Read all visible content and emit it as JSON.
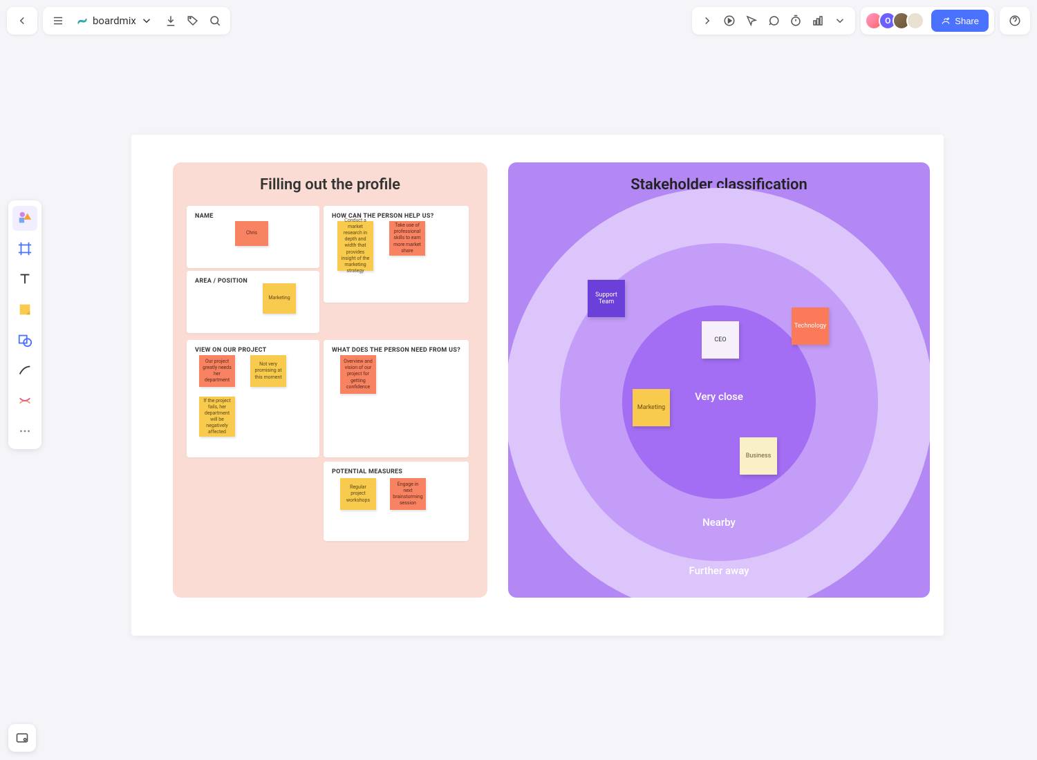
{
  "app": {
    "name": "boardmix",
    "avatar_letter": "O"
  },
  "share": {
    "label": "Share"
  },
  "profile": {
    "title": "Filling out the profile",
    "sections": {
      "name": {
        "label": "NAME",
        "notes": [
          "Chris"
        ]
      },
      "area": {
        "label": "AREA / POSITION",
        "notes": [
          "Marketing"
        ]
      },
      "help": {
        "label": "HOW CAN THE PERSON HELP US?",
        "notes": [
          "Conduct a market research in depth and width that provides insight of the marketing strategy",
          "Take use of professional skills to earn more market share"
        ]
      },
      "view": {
        "label": "VIEW ON OUR PROJECT",
        "notes": [
          "Our project greatly needs her department",
          "Not very promising at this moment",
          "If the project fails, her department will be negatively affected"
        ]
      },
      "need": {
        "label": "WHAT DOES THE PERSON NEED FROM US?",
        "notes": [
          "Overview and vision of our project for getting confidence"
        ]
      },
      "measures": {
        "label": "POTENTIAL MEASURES",
        "notes": [
          "Regular project workshops",
          "Engage in next brainstorming session"
        ]
      }
    }
  },
  "stakeholder": {
    "title": "Stakeholder classification",
    "rings": {
      "inner": "Very close",
      "mid": "Nearby",
      "outer": "Further away"
    },
    "items": {
      "ceo": "CEO",
      "support": "Support Team",
      "tech": "Technology",
      "marketing": "Marketing",
      "business": "Business"
    }
  }
}
